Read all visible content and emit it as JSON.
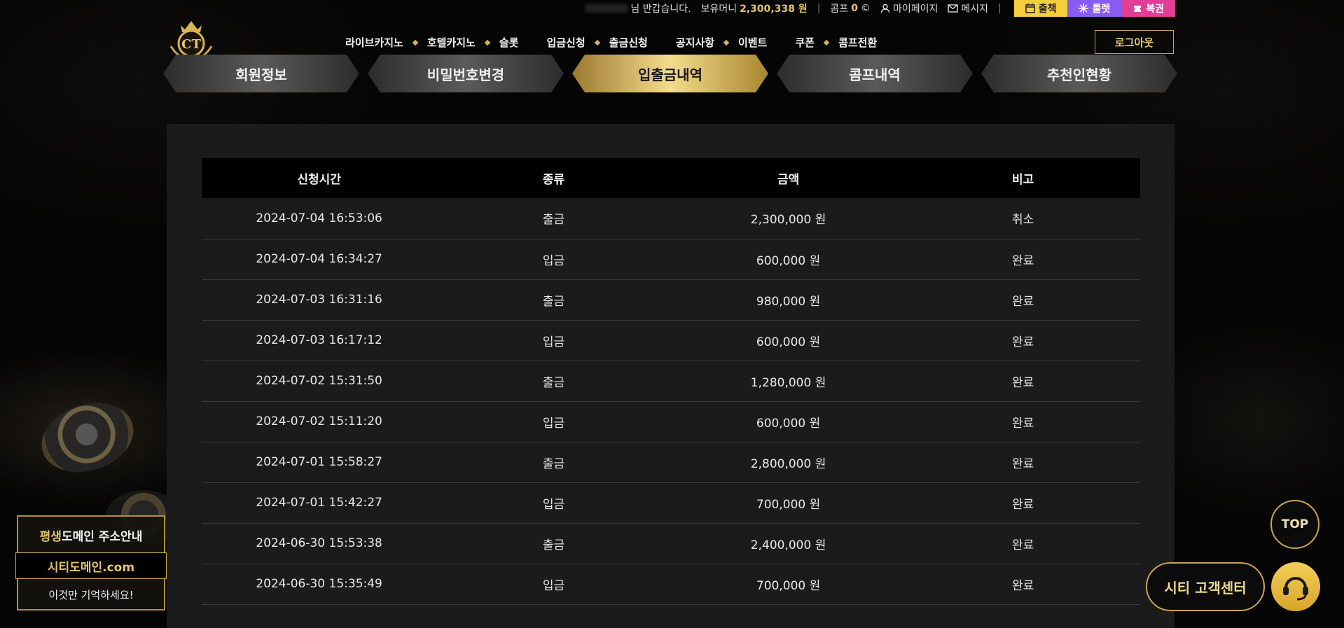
{
  "topbar": {
    "greeting": "님 반갑습니다.",
    "balance_label": "보유머니",
    "balance_value": "2,300,338 원",
    "comp_label": "콤프",
    "comp_value": "0",
    "comp_unit": "©",
    "mypage": "마이페이지",
    "message": "메시지",
    "attendance": "출책",
    "roulette": "룰렛",
    "lottery": "복권"
  },
  "nav": {
    "items": [
      "라이브카지노",
      "호텔카지노",
      "슬롯",
      "입금신청",
      "출금신청",
      "공지사항",
      "이벤트",
      "쿠폰",
      "콤프전환"
    ],
    "logout": "로그아웃"
  },
  "tabs": [
    {
      "label": "회원정보"
    },
    {
      "label": "비밀번호변경"
    },
    {
      "label": "입출금내역"
    },
    {
      "label": "콤프내역"
    },
    {
      "label": "추천인현황"
    }
  ],
  "table": {
    "headers": [
      "신청시간",
      "종류",
      "금액",
      "비고"
    ],
    "rows": [
      {
        "time": "2024-07-04 16:53:06",
        "type": "출금",
        "amount": "2,300,000 원",
        "note": "취소"
      },
      {
        "time": "2024-07-04 16:34:27",
        "type": "입금",
        "amount": "600,000 원",
        "note": "완료"
      },
      {
        "time": "2024-07-03 16:31:16",
        "type": "출금",
        "amount": "980,000 원",
        "note": "완료"
      },
      {
        "time": "2024-07-03 16:17:12",
        "type": "입금",
        "amount": "600,000 원",
        "note": "완료"
      },
      {
        "time": "2024-07-02 15:31:50",
        "type": "출금",
        "amount": "1,280,000 원",
        "note": "완료"
      },
      {
        "time": "2024-07-02 15:11:20",
        "type": "입금",
        "amount": "600,000 원",
        "note": "완료"
      },
      {
        "time": "2024-07-01 15:58:27",
        "type": "출금",
        "amount": "2,800,000 원",
        "note": "완료"
      },
      {
        "time": "2024-07-01 15:42:27",
        "type": "입금",
        "amount": "700,000 원",
        "note": "완료"
      },
      {
        "time": "2024-06-30 15:53:38",
        "type": "출금",
        "amount": "2,400,000 원",
        "note": "완료"
      },
      {
        "time": "2024-06-30 15:35:49",
        "type": "입금",
        "amount": "700,000 원",
        "note": "완료"
      }
    ]
  },
  "domain_box": {
    "line1_highlight": "평생",
    "line1_rest": "도메인 주소안내",
    "domain": "시티도메인.com",
    "line3": "이것만 기억하세요!"
  },
  "top_button": "TOP",
  "customer_center": "시티 고객센터",
  "colors": {
    "gold": "#e5c56b",
    "attend": "#f5cf3b",
    "roulette": "#8a5cf6",
    "lottery": "#e23d97"
  }
}
